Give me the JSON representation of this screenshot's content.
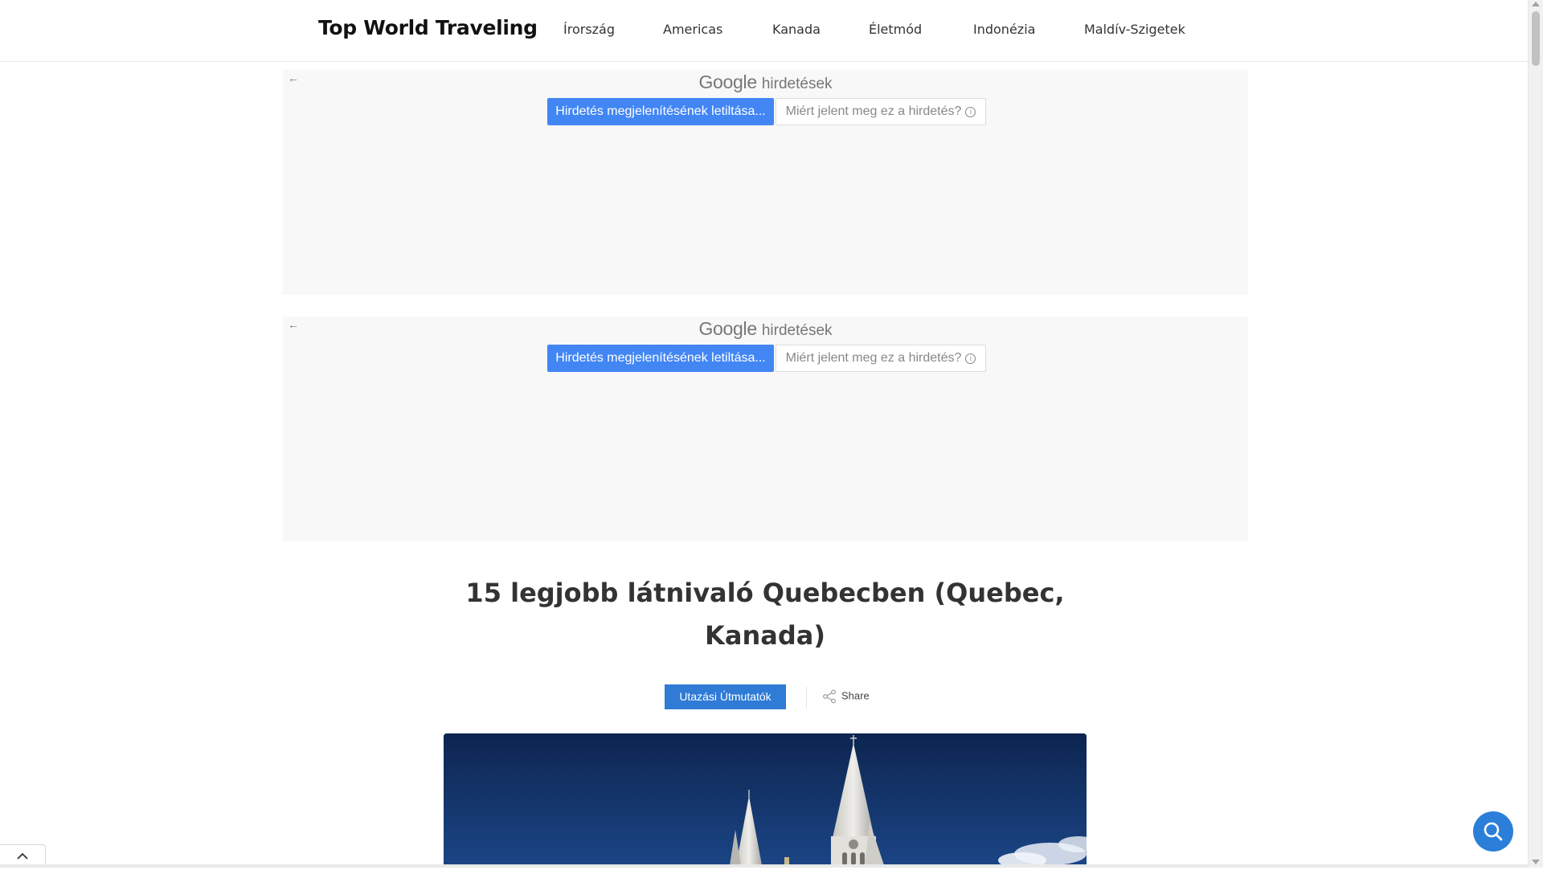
{
  "header": {
    "brand": "Top World Traveling",
    "nav": [
      "Írország",
      "Americas",
      "Kanada",
      "Életmód",
      "Indonézia",
      "Maldív-Szigetek"
    ]
  },
  "ads": [
    {
      "google": "Google",
      "label": "hirdetések",
      "block_button": "Hirdetés megjelenítésének letiltása...",
      "why_button": "Miért jelent meg ez a hirdetés?"
    },
    {
      "google": "Google",
      "label": "hirdetések",
      "block_button": "Hirdetés megjelenítésének letiltása...",
      "why_button": "Miért jelent meg ez a hirdetés?"
    }
  ],
  "article": {
    "title": "15 legjobb látnivaló Quebecben (Quebec, Kanada)",
    "category": "Utazási Útmutatók",
    "share": "Share"
  },
  "icons": {
    "back": "arrow-left-icon",
    "info": "info-icon",
    "share": "share-icon",
    "search": "search-icon",
    "back_to_top": "chevron-up-icon"
  },
  "colors": {
    "ad_button": "#4286f4",
    "category": "#2f7bd6",
    "search_fab": "#2b7fd9",
    "sky": "#12305f"
  }
}
